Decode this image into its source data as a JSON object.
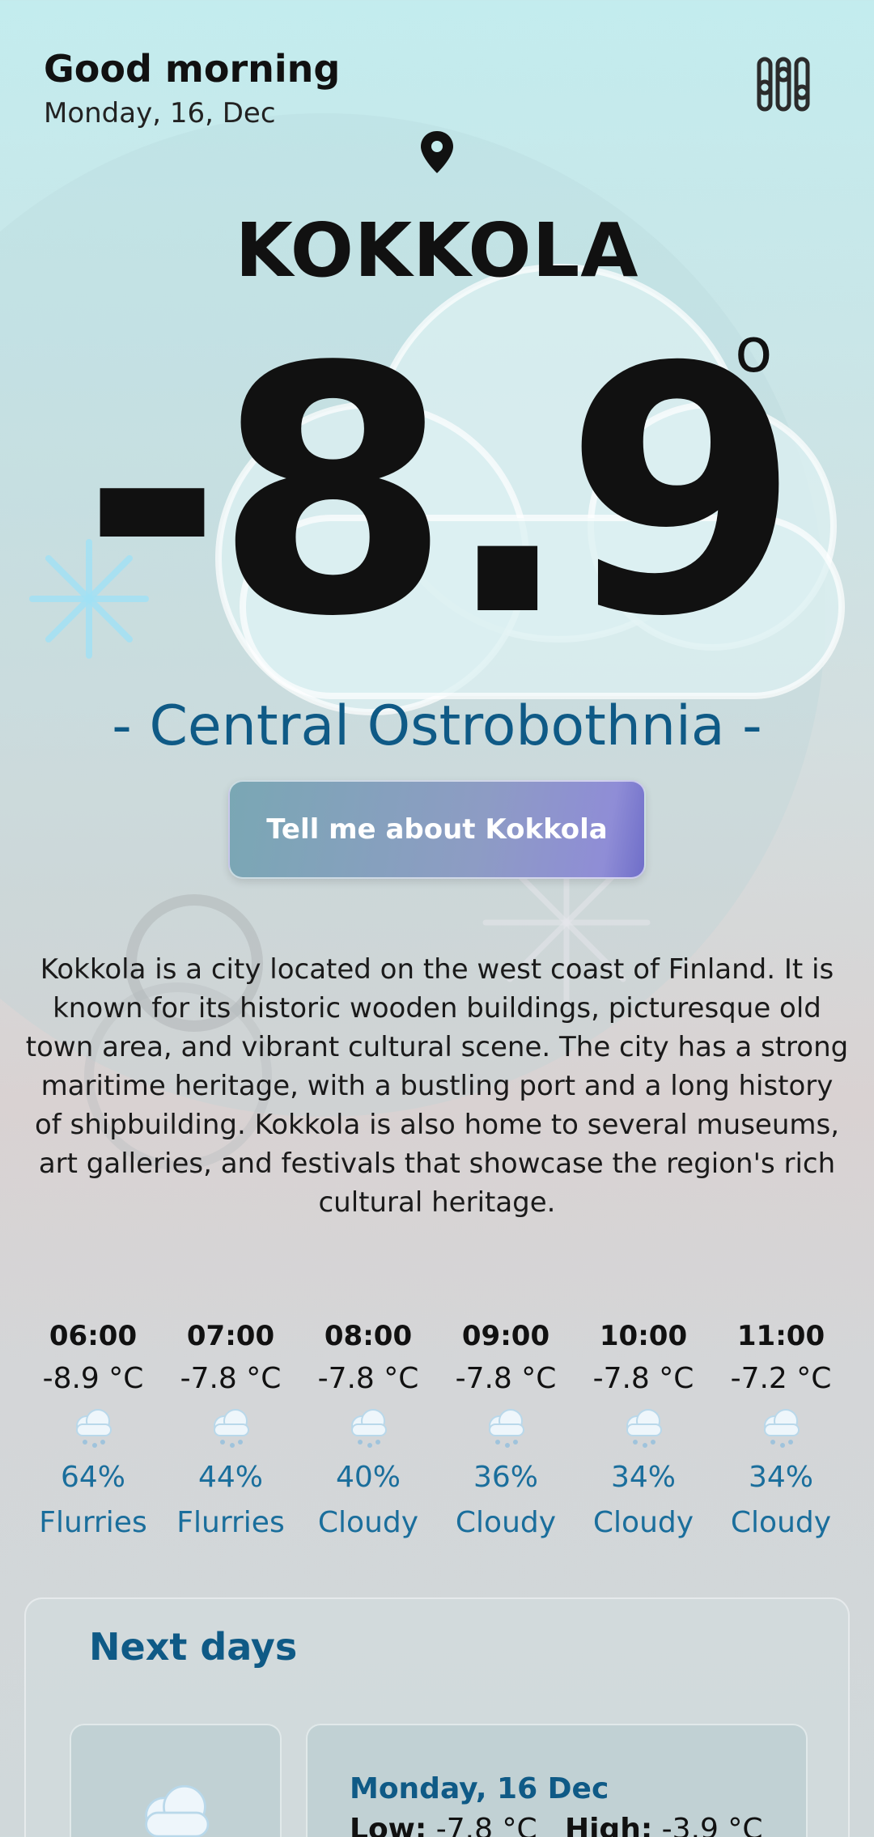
{
  "header": {
    "greeting": "Good morning",
    "date": "Monday, 16, Dec"
  },
  "icons": {
    "settings": "sliders-icon",
    "location": "location-pin-icon",
    "weather": "cloud-snow-icon"
  },
  "location": {
    "city": "KOKKOLA",
    "region": "- Central Ostrobothnia -"
  },
  "current": {
    "temperature": "-8.9",
    "degree_symbol": "o"
  },
  "about_button": {
    "label": "Tell me about  Kokkola"
  },
  "about_text": "Kokkola is a city located on the west coast of Finland. It is known for its historic wooden buildings, picturesque old town area, and vibrant cultural scene. The city has a strong maritime heritage, with a bustling port and a long history of shipbuilding. Kokkola is also home to several museums, art galleries, and festivals that showcase the region's rich cultural heritage.",
  "hourly": [
    {
      "time": "06:00",
      "temp": "-8.9 °C",
      "pct": "64%",
      "condition": "Flurries"
    },
    {
      "time": "07:00",
      "temp": "-7.8 °C",
      "pct": "44%",
      "condition": "Flurries"
    },
    {
      "time": "08:00",
      "temp": "-7.8 °C",
      "pct": "40%",
      "condition": "Cloudy"
    },
    {
      "time": "09:00",
      "temp": "-7.8 °C",
      "pct": "36%",
      "condition": "Cloudy"
    },
    {
      "time": "10:00",
      "temp": "-7.8 °C",
      "pct": "34%",
      "condition": "Cloudy"
    },
    {
      "time": "11:00",
      "temp": "-7.2 °C",
      "pct": "34%",
      "condition": "Cloudy"
    }
  ],
  "next_days": {
    "title": "Next days",
    "items": [
      {
        "date": "Monday, 16 Dec",
        "low_label": "Low:",
        "low": "-7.8 °C",
        "high_label": "High:",
        "high": "-3.9 °C"
      }
    ]
  },
  "colors": {
    "accent": "#0f5a86",
    "hourly_text": "#1a6e9c",
    "button_start": "#7aa7b4",
    "button_end": "#6f6ec9"
  }
}
